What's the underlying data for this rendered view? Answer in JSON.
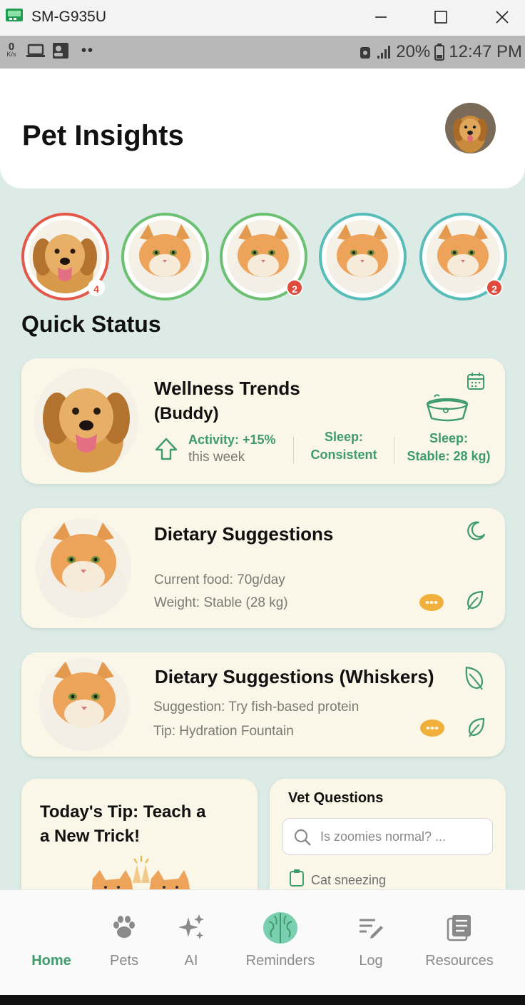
{
  "window": {
    "title": "SM-G935U"
  },
  "statusbar": {
    "net_speed": "0",
    "net_unit": "K/s",
    "dots": "••",
    "battery": "20%",
    "time": "12:47 PM"
  },
  "header": {
    "title": "Pet Insights"
  },
  "pets": [
    {
      "kind": "dog",
      "ring": "#e4584a",
      "badge": "4"
    },
    {
      "kind": "cat",
      "ring": "#6cc072",
      "badge": ""
    },
    {
      "kind": "cat",
      "ring": "#6cc072",
      "badge": "2"
    },
    {
      "kind": "cat",
      "ring": "#58bcb8",
      "badge": ""
    },
    {
      "kind": "cat",
      "ring": "#58bcb8",
      "badge": "2"
    }
  ],
  "quick_status": {
    "title": "Quick Status"
  },
  "wellness": {
    "title_line1": "Wellness Trends",
    "title_line2": "(Buddy)",
    "activity_value": "Activity: +15%",
    "activity_period": "this week",
    "sleep1_line1": "Sleep:",
    "sleep1_line2": "Consistent",
    "sleep2_line1": "Sleep:",
    "sleep2_line2": "Stable: 28 kg)"
  },
  "dietary": {
    "title": "Dietary Suggestions",
    "line1": "Current food: 70g/day",
    "line2": "Weight: Stable (28 kg)"
  },
  "dietary_whiskers": {
    "title": "Dietary Suggestions (Whiskers)",
    "line1": "Suggestion: Try fish-based protein",
    "line2": "Tip: Hydration Fountain"
  },
  "tip": {
    "line1": "Today's Tip: Teach a",
    "line2": "a New Trick!"
  },
  "vet": {
    "title": "Vet Questions",
    "search_placeholder": "Is zoomies normal? ...",
    "item1": "Cat sneezing"
  },
  "nav": [
    {
      "label": "Home",
      "icon": "home"
    },
    {
      "label": "Pets",
      "icon": "paw-icon"
    },
    {
      "label": "AI",
      "icon": "sparkle-icon"
    },
    {
      "label": "Reminders",
      "icon": "brain-icon"
    },
    {
      "label": "Log",
      "icon": "edit-list-icon"
    },
    {
      "label": "Resources",
      "icon": "document-icon"
    }
  ],
  "colors": {
    "accent": "#3e9b6b",
    "background": "#dcebe5",
    "card": "#faf6e8",
    "badge": "#e04a3a",
    "food_icon": "#f0b13c"
  }
}
